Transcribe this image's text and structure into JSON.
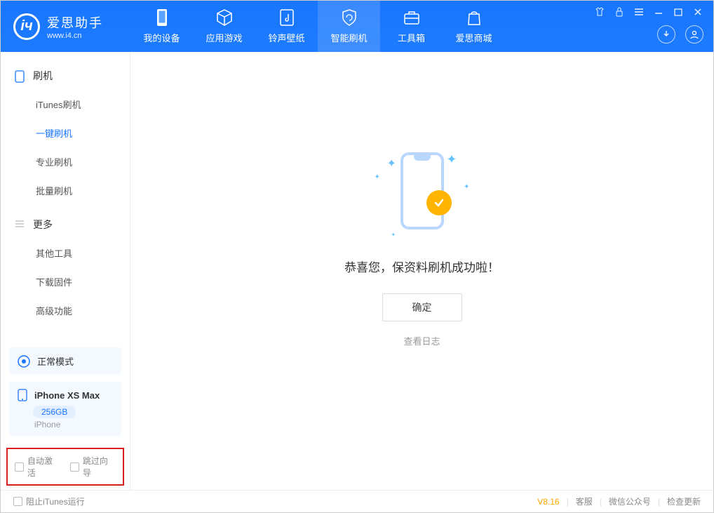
{
  "brand": {
    "name": "爱思助手",
    "url": "www.i4.cn"
  },
  "nav": {
    "my_device": "我的设备",
    "app_games": "应用游戏",
    "ringtone_wall": "铃声壁纸",
    "smart_flash": "智能刷机",
    "toolbox": "工具箱",
    "store": "爱思商城"
  },
  "sidebar": {
    "group1": {
      "title": "刷机",
      "items": [
        "iTunes刷机",
        "一键刷机",
        "专业刷机",
        "批量刷机"
      ]
    },
    "group2": {
      "title": "更多",
      "items": [
        "其他工具",
        "下载固件",
        "高级功能"
      ]
    }
  },
  "mode": {
    "label": "正常模式"
  },
  "device": {
    "name": "iPhone XS Max",
    "capacity": "256GB",
    "type": "iPhone"
  },
  "options": {
    "auto_activate": "自动激活",
    "skip_guide": "跳过向导"
  },
  "main": {
    "success_msg": "恭喜您，保资料刷机成功啦！",
    "ok": "确定",
    "view_log": "查看日志"
  },
  "status": {
    "block_itunes": "阻止iTunes运行",
    "version": "V8.16",
    "support": "客服",
    "wechat": "微信公众号",
    "update": "检查更新"
  }
}
